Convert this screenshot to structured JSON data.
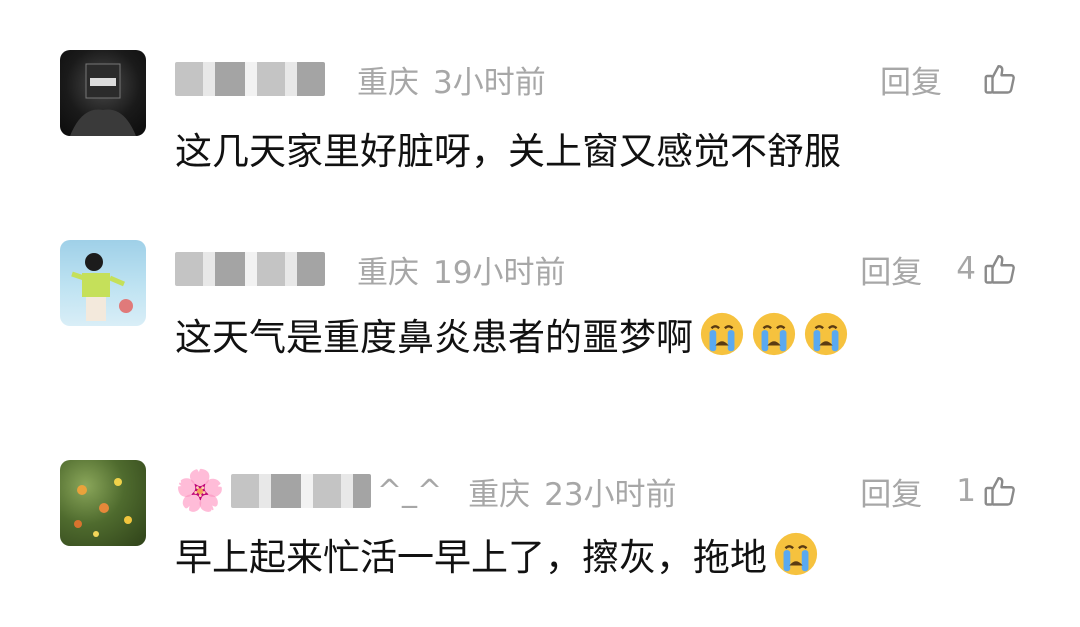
{
  "comments": [
    {
      "nickname_suffix": "",
      "location": "重庆",
      "time": "3小时前",
      "reply_label": "回复",
      "like_count": "",
      "text": "这几天家里好脏呀，关上窗又感觉不舒服",
      "emojis": []
    },
    {
      "nickname_suffix": "",
      "location": "重庆",
      "time": "19小时前",
      "reply_label": "回复",
      "like_count": "4",
      "text": "这天气是重度鼻炎患者的噩梦啊",
      "emojis": [
        "crying-face-emoji",
        "crying-face-emoji",
        "crying-face-emoji"
      ]
    },
    {
      "nickname_suffix": "^_^",
      "location": "重庆",
      "time": "23小时前",
      "reply_label": "回复",
      "like_count": "1",
      "text": "早上起来忙活一早上了，擦灰，拖地",
      "emojis": [
        "crying-face-emoji"
      ]
    }
  ],
  "colors": {
    "meta": "#a7a7a7",
    "text": "#111111",
    "emoji": "#f6c23e"
  }
}
